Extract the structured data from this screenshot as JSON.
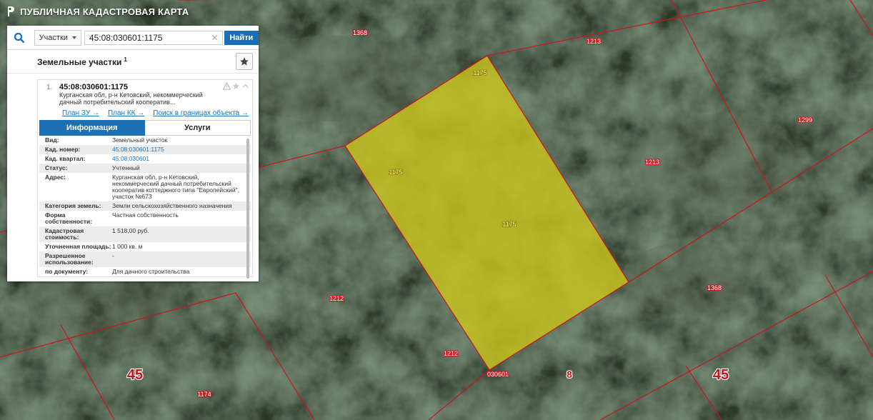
{
  "header": {
    "title": "ПУБЛИЧНАЯ КАДАСТРОВАЯ КАРТА"
  },
  "search": {
    "type_label": "Участки",
    "query": "45:08:030601:1175",
    "find_label": "Найти"
  },
  "section": {
    "title": "Земельные участки",
    "count": "1"
  },
  "result": {
    "number": "1.",
    "cadastral": "45:08:030601:1175",
    "address_short_1": "Курганская обл, р-н Кетовский, некоммерческий",
    "address_short_2": "дачный потребительский кооператив..."
  },
  "links": {
    "plan_zu": "План ЗУ →",
    "plan_kk": "План КК →",
    "search_bounds": "Поиск в границах объекта →"
  },
  "tabs": {
    "info": "Информация",
    "services": "Услуги"
  },
  "details": [
    {
      "k": "Вид:",
      "v": "Земельный участок"
    },
    {
      "k": "Кад. номер:",
      "v": "45:08:030601:1175",
      "link": true
    },
    {
      "k": "Кад. квартал:",
      "v": "45:08:030601",
      "link": true
    },
    {
      "k": "Статус:",
      "v": "Учтенный"
    },
    {
      "k": "Адрес:",
      "v": "Курганская обл, р-н Кетовский, некоммерческий дачный потребительский кооператив коттеджного типа \"Европейский\", участок №673"
    },
    {
      "k": "Категория земель:",
      "v": "Земли сельскохозяйственного назначения"
    },
    {
      "k": "Форма собственности:",
      "v": "Частная собственность"
    },
    {
      "k": "Кадастровая стоимость:",
      "v": "1 518,00 руб."
    },
    {
      "k": "Уточненная площадь:",
      "v": "1 000 кв. м"
    },
    {
      "k": "Разрешенное использование:",
      "v": "-"
    },
    {
      "k": "по документу:",
      "v": "Для дачного строительства"
    }
  ],
  "map_labels": {
    "l1368a": "1368",
    "l1213a": "1213",
    "l1213b": "1213",
    "l1299": "1299",
    "l1175a": "1175",
    "l1175b": "1175",
    "l1175c": "1175",
    "l1368b": "1368",
    "l1212a": "1212",
    "l1212b": "1212",
    "l1174": "1174",
    "l030601": "030601",
    "l8": "8",
    "l45a": "45",
    "l45b": "45"
  },
  "colors": {
    "parcel_fill": "#c9c41e",
    "boundary": "#c8161d",
    "accent": "#1a6fb5"
  }
}
